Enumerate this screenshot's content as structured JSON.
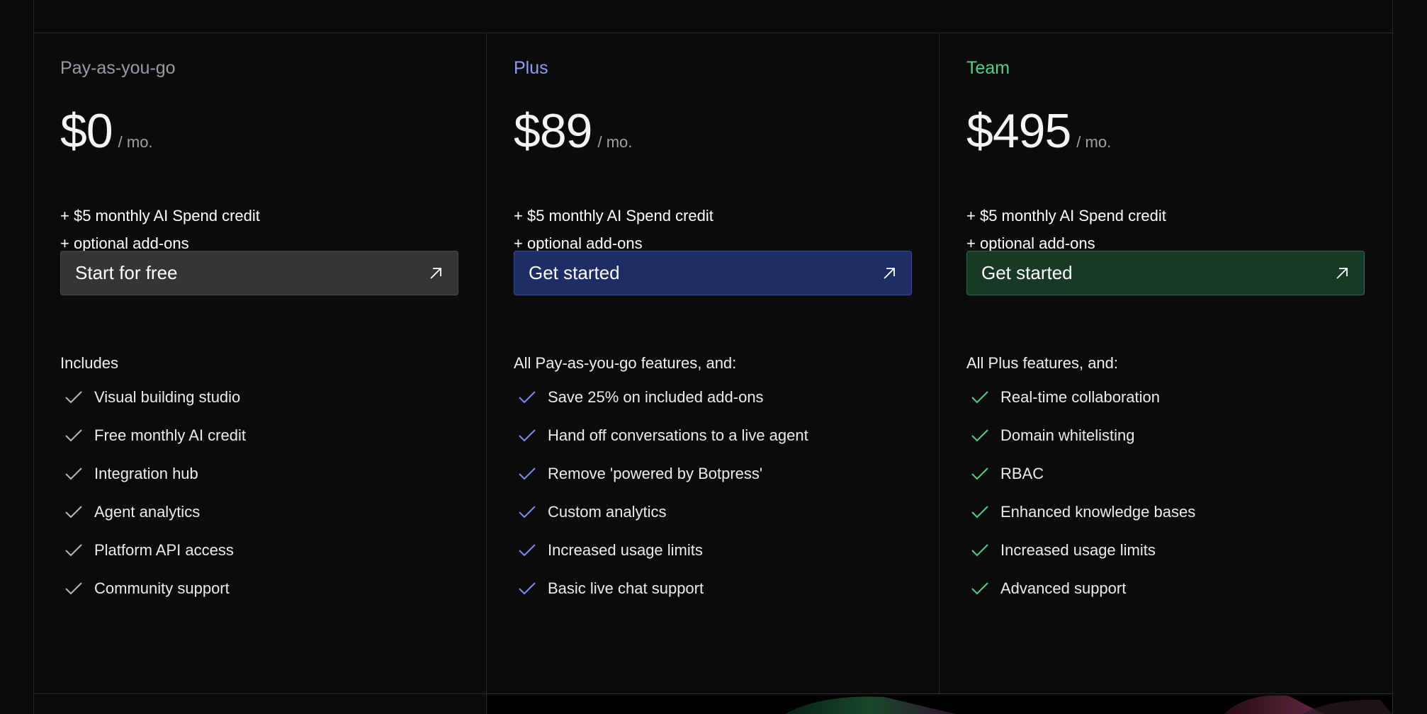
{
  "colors": {
    "background": "#0b0b0c",
    "border": "#2a2a2c",
    "payg_accent": "#9a9aa2",
    "plus_accent": "#8f9bf5",
    "team_accent": "#4fd18c",
    "payg_button_bg": "#353538",
    "plus_button_bg": "#1f2d66",
    "team_button_bg": "#173a26"
  },
  "plans": [
    {
      "name": "Pay-as-you-go",
      "price": "$0",
      "period": "/ mo.",
      "perks": [
        "+ $5 monthly AI Spend credit",
        "+ optional add-ons"
      ],
      "cta": "Start for free",
      "cta_icon": "arrow-up-right-icon",
      "features_heading": "Includes",
      "features": [
        "Visual building studio",
        "Free monthly AI credit",
        "Integration hub",
        "Agent analytics",
        "Platform API access",
        "Community support"
      ]
    },
    {
      "name": "Plus",
      "price": "$89",
      "period": "/ mo.",
      "perks": [
        "+ $5 monthly AI Spend credit",
        "+ optional add-ons"
      ],
      "cta": "Get started",
      "cta_icon": "arrow-up-right-icon",
      "features_heading": "All Pay-as-you-go features, and:",
      "features": [
        "Save 25% on included add-ons",
        "Hand off conversations to a live agent",
        "Remove 'powered by Botpress'",
        "Custom analytics",
        "Increased usage limits",
        "Basic live chat support"
      ]
    },
    {
      "name": "Team",
      "price": "$495",
      "period": "/ mo.",
      "perks": [
        "+ $5 monthly AI Spend credit",
        "+ optional add-ons"
      ],
      "cta": "Get started",
      "cta_icon": "arrow-up-right-icon",
      "features_heading": "All Plus features, and:",
      "features": [
        "Real-time collaboration",
        "Domain whitelisting",
        "RBAC",
        "Enhanced knowledge bases",
        "Increased usage limits",
        "Advanced support"
      ]
    }
  ]
}
